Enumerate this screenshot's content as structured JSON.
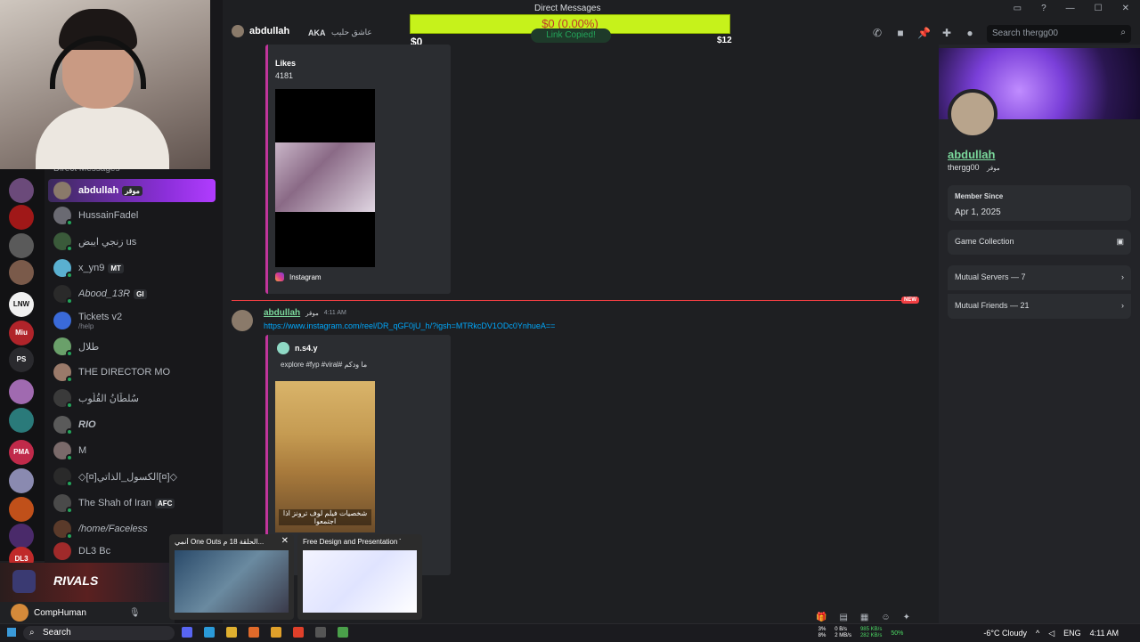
{
  "window": {
    "title": "Direct Messages"
  },
  "donation": {
    "amount": "$0 (0.00%)",
    "low": "$0",
    "high": "$12",
    "progress": 0
  },
  "toast": "Link Copied!",
  "topbar": {
    "user": "abdullah",
    "aka": "AKA",
    "aka_name": "عاشق حليب",
    "search_placeholder": "Search thergg00"
  },
  "servers": [
    {
      "label": ""
    },
    {
      "label": ""
    },
    {
      "label": ""
    },
    {
      "label": ""
    },
    {
      "label": "LNW"
    },
    {
      "label": "Miu"
    },
    {
      "label": "PS"
    },
    {
      "label": ""
    },
    {
      "label": ""
    },
    {
      "label": "PMA"
    },
    {
      "label": ""
    },
    {
      "label": ""
    },
    {
      "label": ""
    },
    {
      "label": "DL3"
    }
  ],
  "dm": {
    "header": "Direct Messages",
    "items": [
      {
        "name": "abdullah",
        "tag": "موقر",
        "sub": ""
      },
      {
        "name": "HussainFadel",
        "tag": "",
        "sub": ""
      },
      {
        "name": "زنجي ايبض us",
        "tag": "",
        "sub": ""
      },
      {
        "name": "x_yn9",
        "tag": "MT",
        "sub": ""
      },
      {
        "name": "Abood_13R",
        "tag": "GI",
        "sub": ""
      },
      {
        "name": "Tickets v2",
        "tag": "",
        "sub": "/help"
      },
      {
        "name": "طلال",
        "tag": "",
        "sub": ""
      },
      {
        "name": "THE DIRECTOR MO",
        "tag": "",
        "sub": ""
      },
      {
        "name": "سُلطَانُ القُلُوب",
        "tag": "",
        "sub": ""
      },
      {
        "name": "RIO",
        "tag": "",
        "sub": ""
      },
      {
        "name": "M",
        "tag": "",
        "sub": ""
      },
      {
        "name": "◇[¤]الكسول_الذاتي[¤]◇",
        "tag": "",
        "sub": ""
      },
      {
        "name": "The Shah of Iran",
        "tag": "AFC",
        "sub": ""
      },
      {
        "name": "/home/Faceless",
        "tag": "",
        "sub": ""
      },
      {
        "name": "DL3 Bc",
        "tag": "",
        "sub": ""
      }
    ]
  },
  "chat": {
    "embed1": {
      "likes_label": "Likes",
      "likes_value": "4181",
      "provider": "Instagram"
    },
    "new_label": "NEW",
    "message": {
      "author": "abdullah",
      "tag": "موقر",
      "time": "4:11 AM",
      "link": "https://www.instagram.com/reel/DR_qGF0jU_h/?igsh=MTRkcDV1ODc0YnhueA==",
      "embed_author": "n.s4.y",
      "embed_text": "explore #fyp #viral# ما ودكم",
      "video_caption": "شخصيات فيلم لوف ترونز اذا اجتمعوا"
    }
  },
  "profile": {
    "name": "abdullah",
    "username": "thergg00",
    "tag": "موقر",
    "member_since_label": "Member Since",
    "member_since": "Apr 1, 2025",
    "game_collection": "Game Collection",
    "mutual_servers": "Mutual Servers — 7",
    "mutual_friends": "Mutual Friends — 21"
  },
  "user_panel": {
    "name": "CompHuman",
    "banner": "RIVALS"
  },
  "previews": [
    {
      "title": "أنمي One Outs الحلقة 18 م..."
    },
    {
      "title": "Free Design and Presentation T..."
    }
  ],
  "taskbar": {
    "search": "Search",
    "cpu": "3%",
    "gpu": "8%",
    "net_up": "0 B/s",
    "net_down": "2 MB/s",
    "disk1": "985 KB/s",
    "disk2": "282 KB/s",
    "battery": "50%",
    "weather": "-6°C Cloudy",
    "lang": "ENG",
    "time": "4:11 AM"
  },
  "colors": {
    "accent": "#8b2fd9",
    "online": "#23a55a",
    "link": "#00a8fc",
    "donation_bar": "#c6f21b"
  }
}
